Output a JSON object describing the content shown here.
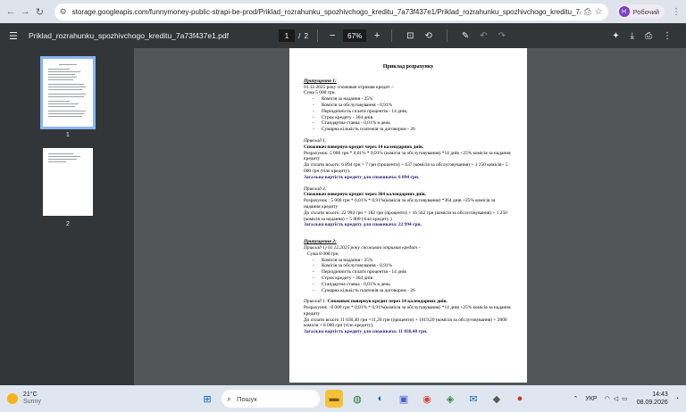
{
  "browser": {
    "url": "storage.googleapis.com/funnymoney-public-strapi-be-prod/Priklad_rozrahunku_spozhivchogo_kreditu_7a73f437e1/Priklad_rozrahunku_spozhivchogo_kreditu_7a73f437e1.pdf",
    "profile_initial": "Н",
    "profile_name": "Робочий"
  },
  "pdf_toolbar": {
    "filename": "Priklad_rozrahunku_spozhivchogo_kreditu_7a73f437e1.pdf",
    "current_page": "1",
    "page_sep": "/",
    "total_pages": "2",
    "zoom": "67%"
  },
  "thumbnails": [
    {
      "label": "1"
    },
    {
      "label": "2"
    }
  ],
  "doc": {
    "title": "Приклад розрахунку",
    "a1_heading": "Припущення 1:",
    "a1_intro": "01.12.2025 року споживач отримав кредит –",
    "a1_sum": "Сума 5 000 грн.",
    "a1_items": [
      "Комісія за надання - 25%",
      "Комісія за обслуговування - 0,91%",
      "Періодичність сплати процентів - 14 днів,",
      "Строк кредиту - 364 днів.",
      "Стандартна ставка - 0,01% в день",
      "Сумарна кількість платежів за договором - 26"
    ],
    "e1_heading": "Приклад 1.",
    "e1_bold": "Споживач повернув кредит через 14 календарних днів.",
    "e1_calc1": "Розрахунок: 5 000 грн * 0,01% * 0,91% (комісія за обслуговування) *14 днів +25% комісія за надання кредиту",
    "e1_pay": "До сплати всього: 6 894 грн = 7 грн (проценти) + 637 (комісія за обслуговування) + 1 250 комісія+ 5 000 грн (тіло кредиту).",
    "e1_total": "Загальна вартість кредиту для споживача: 6 894 грн.",
    "e2_heading": "Приклад 2.",
    "e2_bold": "Споживач повернув кредит через 364 календарних днів.",
    "e2_calc": "Розрахунок : 5 000 грн * 0,01% * 0,91%(комісія за обслуговування) *364 днів +25% комісія за надання кредиту",
    "e2_pay": "До сплати всього: 22 994 грн = 182 грн (проценти) + 16 562 грн (комісія за обслуговування) + 1 250 (комісія за надання) + 5 000 (тіло кредиту )",
    "e2_total": "Загальна вартість кредиту для споживача: 22 994 грн.",
    "a2_heading": "Припущення 2:",
    "a2_intro": "Приклад 1) 01.12.2025 року споживач отримав кредит –",
    "a2_sum": "Сума 8 000 грн.",
    "a2_items": [
      "Комісія за надання - 25%",
      "Комісія за обслуговування - 0,91%",
      "Періодичність сплати процентів - 14 днів",
      "Строк кредиту - 364 днів",
      "Стандартна ставка - 0,01% в день",
      "Сумарна кількість платежів за договором - 26"
    ],
    "e3_heading": "Приклад 1.",
    "e3_bold": "Споживач повернув кредит через 14 календарних днів.",
    "e3_calc": "Розрахунок : 8 000 грн * 0,01% * 0,91%(комісія за обслуговування) *14 днів +25% комісія за надання кредиту",
    "e3_pay": "До сплати всього 11 030,40 грн =11,20 грн (проценти) + 1019,20 (комісія за обслуговування) + 2000 комісія + 8 000 грн (тіло кредиту).",
    "e3_total": "Загальна вартість кредиту для споживача: 11 030,40 грн."
  },
  "taskbar": {
    "temp": "21°C",
    "weather": "Sunny",
    "search": "Пошук",
    "lang": "УКР",
    "time": "14:43",
    "date": "08.09.2026"
  }
}
